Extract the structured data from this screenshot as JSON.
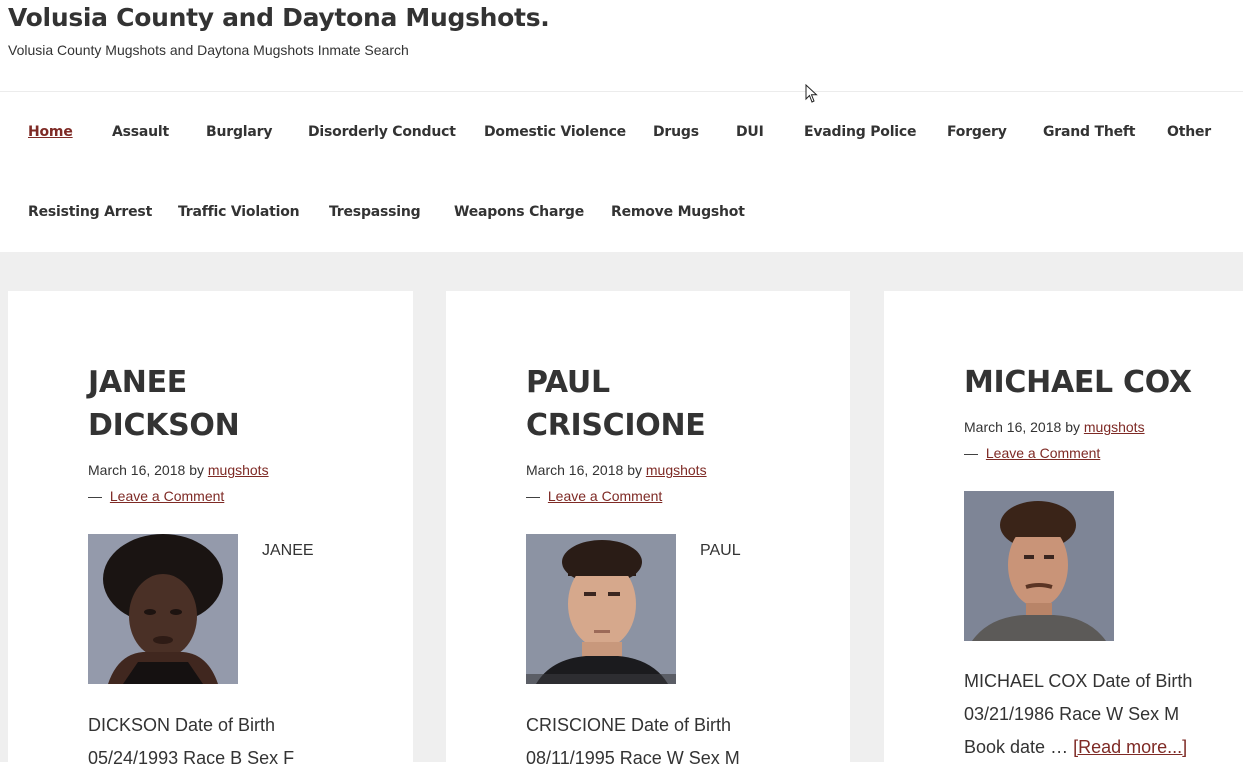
{
  "header": {
    "site_title": "Volusia County and Daytona Mugshots.",
    "site_description": "Volusia County Mugshots and Daytona Mugshots Inmate Search"
  },
  "nav": {
    "items": [
      {
        "label": "Home",
        "active": true
      },
      {
        "label": "Assault"
      },
      {
        "label": "Burglary"
      },
      {
        "label": "Disorderly Conduct"
      },
      {
        "label": "Domestic Violence"
      },
      {
        "label": "Drugs"
      },
      {
        "label": "DUI"
      },
      {
        "label": "Evading Police"
      },
      {
        "label": "Forgery"
      },
      {
        "label": "Grand Theft"
      },
      {
        "label": "Other"
      },
      {
        "label": "Resisting Arrest"
      },
      {
        "label": "Traffic Violation"
      },
      {
        "label": "Trespassing"
      },
      {
        "label": "Weapons Charge"
      },
      {
        "label": "Remove Mugshot"
      }
    ]
  },
  "posts": [
    {
      "title_line1": "JANEE",
      "title_line2": "DICKSON",
      "date": "March 16, 2018",
      "by": "by",
      "author": "mugshots",
      "dash": "—",
      "comment_link": "Leave a Comment",
      "first_name": "JANEE",
      "excerpt_line1": "DICKSON Date of Birth",
      "excerpt_line2": "05/24/1993 Race B Sex F"
    },
    {
      "title_line1": "PAUL",
      "title_line2": "CRISCIONE",
      "date": "March 16, 2018",
      "by": "by",
      "author": "mugshots",
      "dash": "—",
      "comment_link": "Leave a Comment",
      "first_name": "PAUL",
      "excerpt_line1": "CRISCIONE Date of Birth",
      "excerpt_line2": "08/11/1995 Race W Sex M"
    },
    {
      "title_line1": "MICHAEL COX",
      "date": "March 16, 2018",
      "by": "by",
      "author": "mugshots",
      "dash": "—",
      "comment_link": "Leave a Comment",
      "excerpt_line1": "MICHAEL COX Date of Birth",
      "excerpt_line2": "03/21/1986 Race W Sex M",
      "excerpt_line3_prefix": "Book date …",
      "read_more": "[Read more...]"
    }
  ],
  "colors": {
    "link": "#7e2a25",
    "text": "#333333",
    "page_bg": "#efefef"
  }
}
